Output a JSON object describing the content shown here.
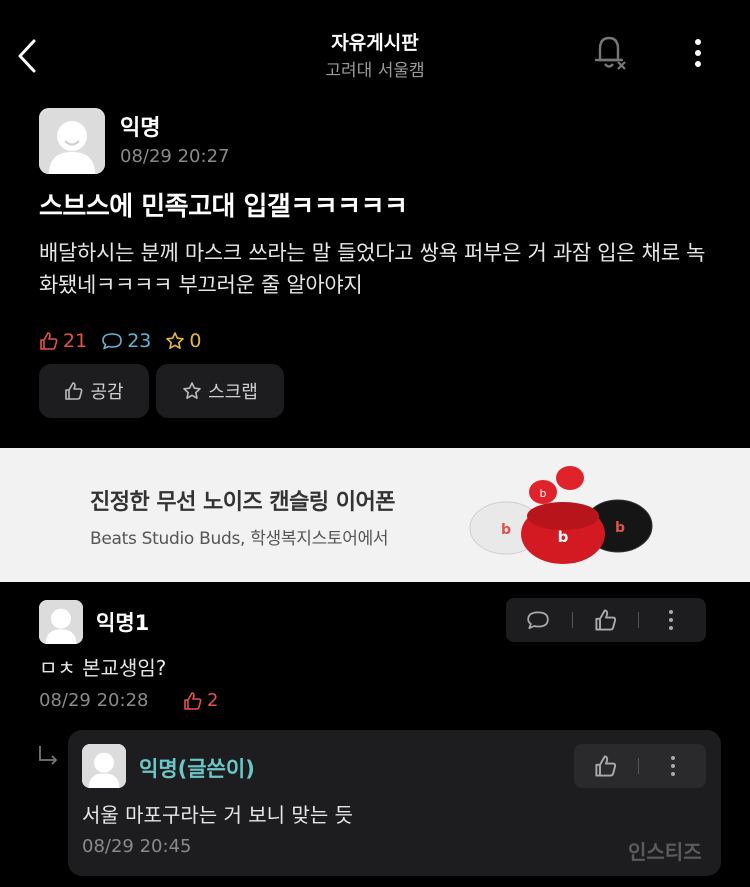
{
  "header": {
    "title": "자유게시판",
    "subtitle": "고려대 서울캠"
  },
  "post": {
    "author": "익명",
    "time": "08/29 20:27",
    "title": "스브스에 민족고대 입갤ㅋㅋㅋㅋㅋ",
    "body": "배달하시는 분께 마스크 쓰라는 말 들었다고 쌍욕 퍼부은 거 과잠 입은 채로 녹화됐네ㅋㅋㅋㅋ 부끄러운 줄 알아야지",
    "likes": "21",
    "comments": "23",
    "scraps": "0",
    "empathy_label": "공감",
    "scrap_label": "스크랩"
  },
  "ad": {
    "title": "진정한 무선 노이즈 캔슬링 이어폰",
    "subtitle": "Beats Studio Buds, 학생복지스토어에서"
  },
  "comments": [
    {
      "author": "익명1",
      "text": "ㅁㅊ 본교생임?",
      "time": "08/29 20:28",
      "likes": "2"
    }
  ],
  "reply": {
    "author": "익명(글쓴이)",
    "text": "서울 마포구라는 거 보니 맞는 듯",
    "time": "08/29 20:45"
  },
  "watermark": "인스티즈",
  "colors": {
    "background": "#000000",
    "like": "#e2534a",
    "comment": "#5fb6d4",
    "scrap": "#e6b646",
    "op_author": "#6bc7c8"
  }
}
